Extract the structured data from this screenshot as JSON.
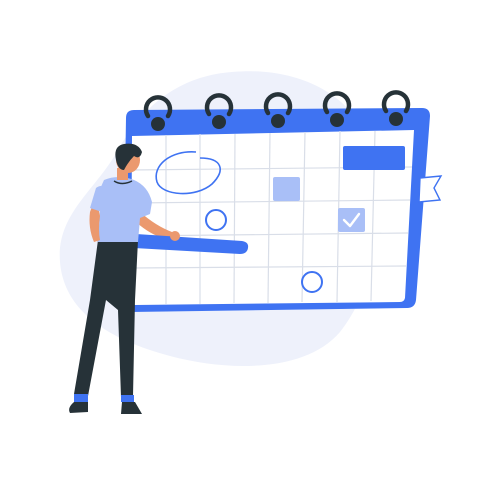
{
  "colors": {
    "background": "#ffffff",
    "blob": "#eef1fb",
    "accent": "#3f73f2",
    "accent_light": "#a9bff7",
    "grid_line": "#d9dee8",
    "ink": "#263238",
    "shirt": "#a9bff7",
    "skin": "#eb996e"
  },
  "calendar": {
    "rings": 5,
    "columns": 8,
    "rows": 5
  },
  "icons": [
    "binder-ring-icon",
    "check-icon",
    "circle-mark-icon",
    "bookmark-flag-icon"
  ]
}
